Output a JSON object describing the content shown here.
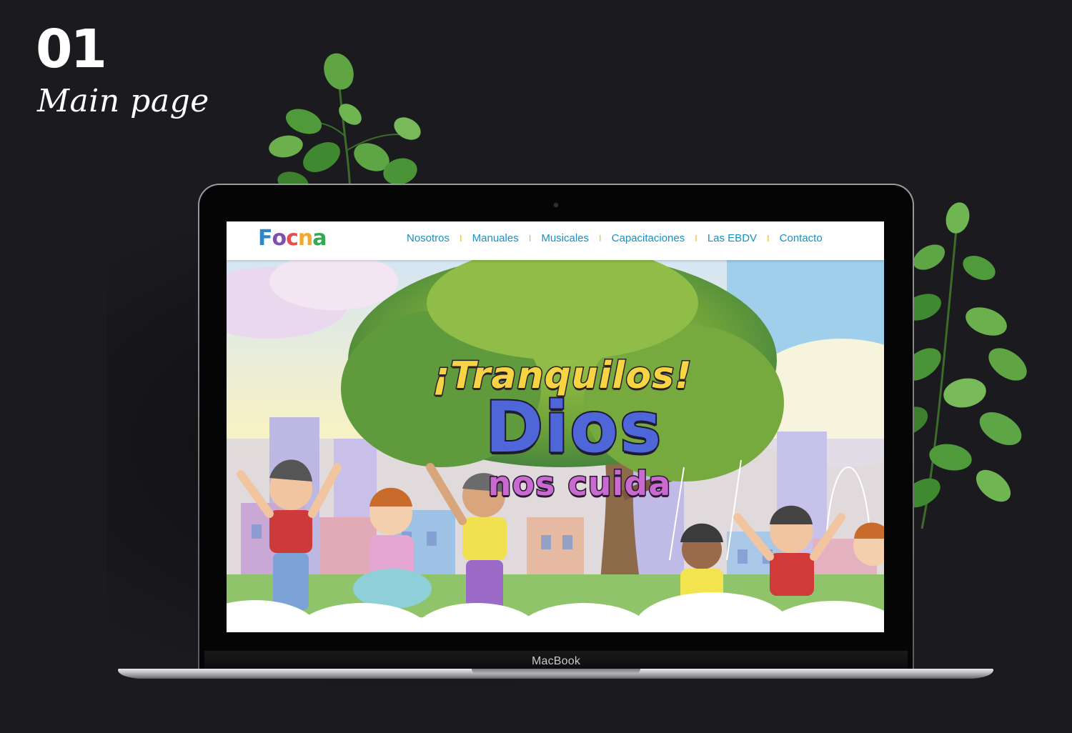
{
  "slide": {
    "number": "01",
    "caption": "Main page"
  },
  "laptop": {
    "brand": "MacBook"
  },
  "site": {
    "logo": {
      "letters": [
        "F",
        "o",
        "c",
        "n",
        "a"
      ],
      "colors": [
        "#2e86c8",
        "#7e4fb0",
        "#e94e4e",
        "#f3a82c",
        "#35a852"
      ]
    },
    "nav": {
      "items": [
        "Nosotros",
        "Manuales",
        "Musicales",
        "Capacitaciones",
        "Las EBDV",
        "Contacto"
      ],
      "separator": "I",
      "link_color": "#1591c6",
      "separator_color": "#f0b92c"
    },
    "hero": {
      "line1": "¡Tranquilos!",
      "line2": "Dios",
      "line3": "nos cuida"
    }
  },
  "colors": {
    "page_background": "#1b1a1f",
    "sky": "#bfdff0",
    "tree": "#7fae3a"
  }
}
